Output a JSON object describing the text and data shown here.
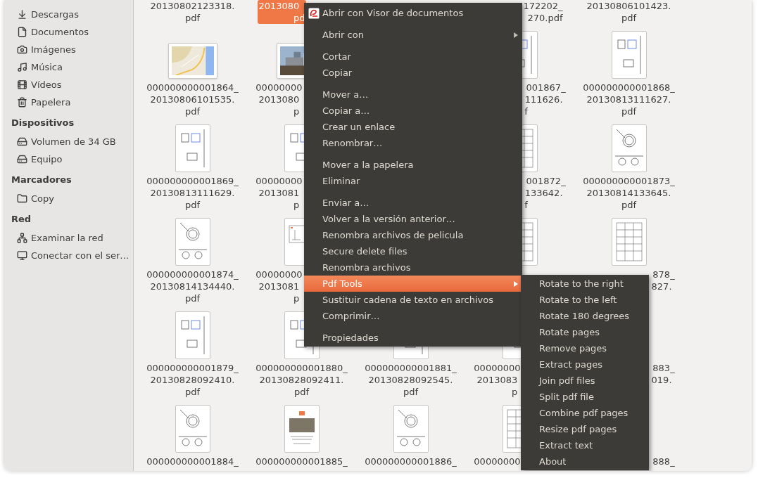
{
  "sidebar": {
    "sections": [
      {
        "items": [
          {
            "label": "Descargas",
            "selected": false
          },
          {
            "label": "Documentos",
            "selected": false
          },
          {
            "label": "Imágenes",
            "selected": false
          },
          {
            "label": "Música",
            "selected": false
          },
          {
            "label": "Vídeos",
            "selected": false
          },
          {
            "label": "Papelera",
            "selected": false
          }
        ]
      },
      {
        "title": "Dispositivos",
        "items": [
          {
            "label": "Volumen de 34 GB",
            "selected": false
          },
          {
            "label": "Equipo",
            "selected": false
          }
        ]
      },
      {
        "title": "Marcadores",
        "items": [
          {
            "label": "Copy",
            "selected": false
          }
        ]
      },
      {
        "title": "Red",
        "items": [
          {
            "label": "Examinar la red",
            "selected": false
          },
          {
            "label": "Conectar con el ser…",
            "selected": false
          }
        ]
      }
    ]
  },
  "files": {
    "rows": [
      {
        "cells": [
          {
            "kind": "file",
            "lines": [
              "20130802123318.",
              "pdf"
            ],
            "selected": false
          },
          {
            "kind": "file",
            "lines": [
              "2013080",
              "pd"
            ],
            "selected": true
          },
          {
            "kind": "covered"
          },
          {
            "kind": "file",
            "lines": [
              "172202_",
              "270.pdf"
            ],
            "selected": false
          },
          {
            "kind": "file",
            "lines": [
              "20130806101423.",
              "pdf"
            ],
            "selected": false
          }
        ]
      },
      {
        "cells": [
          {
            "kind": "file",
            "lines": [
              "000000000001864_",
              "20130806101535.",
              "pdf"
            ],
            "selected": false
          },
          {
            "kind": "file",
            "lines": [
              "00000000",
              "2013080",
              "p"
            ],
            "selected": false
          },
          {
            "kind": "covered"
          },
          {
            "kind": "file",
            "lines": [
              "001867_",
              "111626.",
              "f"
            ],
            "selected": false
          },
          {
            "kind": "file",
            "lines": [
              "000000000001868_",
              "20130813111627.",
              "pdf"
            ],
            "selected": false
          }
        ]
      },
      {
        "cells": [
          {
            "kind": "file",
            "lines": [
              "000000000001869_",
              "20130813111629.",
              "pdf"
            ],
            "selected": false
          },
          {
            "kind": "file",
            "lines": [
              "00000000",
              "2013081",
              "p"
            ],
            "selected": false
          },
          {
            "kind": "covered"
          },
          {
            "kind": "file",
            "lines": [
              "001872_",
              "133642.",
              "f"
            ],
            "selected": false
          },
          {
            "kind": "file",
            "lines": [
              "000000000001873_",
              "20130814133645.",
              "pdf"
            ],
            "selected": false
          }
        ]
      },
      {
        "cells": [
          {
            "kind": "file",
            "lines": [
              "000000000001874_",
              "20130814134440.",
              "pdf"
            ],
            "selected": false
          },
          {
            "kind": "file",
            "lines": [
              "00000000",
              "2013081",
              "p"
            ],
            "selected": false
          },
          {
            "kind": "covered"
          },
          {
            "kind": "covered"
          },
          {
            "kind": "file",
            "lines": [
              "878_",
              "827."
            ],
            "selected": false
          }
        ]
      },
      {
        "cells": [
          {
            "kind": "file",
            "lines": [
              "000000000001879_",
              "20130828092410.",
              "pdf"
            ],
            "selected": false
          },
          {
            "kind": "file",
            "lines": [
              "000000000001880_",
              "20130828092411.",
              "pdf"
            ],
            "selected": false
          },
          {
            "kind": "file",
            "lines": [
              "000000000001881_",
              "20130828092545.",
              "pdf"
            ],
            "selected": false
          },
          {
            "kind": "file",
            "lines": [
              "00000000",
              "2013083",
              "p"
            ],
            "selected": false
          },
          {
            "kind": "file",
            "lines": [
              "883_",
              "019."
            ],
            "selected": false
          }
        ]
      },
      {
        "cells": [
          {
            "kind": "file",
            "lines": [
              "000000000001884_"
            ],
            "selected": false
          },
          {
            "kind": "file",
            "lines": [
              "000000000001885_"
            ],
            "selected": false
          },
          {
            "kind": "file",
            "lines": [
              "000000000001886_"
            ],
            "selected": false
          },
          {
            "kind": "file",
            "lines": [
              "00000000"
            ],
            "selected": false
          },
          {
            "kind": "file",
            "lines": [
              "888_"
            ],
            "selected": false
          }
        ]
      }
    ]
  },
  "context_menu": {
    "groups": [
      {
        "items": [
          {
            "label": "Abrir con Visor de documentos",
            "submenu": false,
            "selected": false
          }
        ]
      },
      {
        "items": [
          {
            "label": "Abrir con",
            "submenu": true,
            "selected": false
          }
        ]
      },
      {
        "items": [
          {
            "label": "Cortar",
            "submenu": false,
            "selected": false
          },
          {
            "label": "Copiar",
            "submenu": false,
            "selected": false
          }
        ]
      },
      {
        "items": [
          {
            "label": "Mover a…",
            "submenu": false,
            "selected": false
          },
          {
            "label": "Copiar a…",
            "submenu": false,
            "selected": false
          },
          {
            "label": "Crear un enlace",
            "submenu": false,
            "selected": false
          },
          {
            "label": "Renombrar…",
            "submenu": false,
            "selected": false
          }
        ]
      },
      {
        "items": [
          {
            "label": "Mover a la papelera",
            "submenu": false,
            "selected": false
          },
          {
            "label": "Eliminar",
            "submenu": false,
            "selected": false
          }
        ]
      },
      {
        "items": [
          {
            "label": "Enviar a…",
            "submenu": false,
            "selected": false
          },
          {
            "label": "Volver a la versión anterior…",
            "submenu": false,
            "selected": false
          },
          {
            "label": "Renombra archivos de pelicula",
            "submenu": false,
            "selected": false
          },
          {
            "label": "Secure delete files",
            "submenu": false,
            "selected": false
          },
          {
            "label": "Renombra archivos",
            "submenu": false,
            "selected": false
          },
          {
            "label": "Pdf Tools",
            "submenu": true,
            "selected": true
          },
          {
            "label": "Sustituir cadena de texto en archivos",
            "submenu": false,
            "selected": false
          },
          {
            "label": "Comprimir…",
            "submenu": false,
            "selected": false
          }
        ]
      },
      {
        "items": [
          {
            "label": "Propiedades",
            "submenu": false,
            "selected": false
          }
        ]
      }
    ]
  },
  "submenu": {
    "items": [
      {
        "label": "Rotate to the right",
        "selected": false
      },
      {
        "label": "Rotate to the left",
        "selected": false
      },
      {
        "label": "Rotate 180 degrees",
        "selected": false
      },
      {
        "label": "Rotate pages",
        "selected": false
      },
      {
        "label": "Remove pages",
        "selected": false
      },
      {
        "label": "Extract pages",
        "selected": false
      },
      {
        "label": "Join pdf files",
        "selected": false
      },
      {
        "label": "Split pdf file",
        "selected": false
      },
      {
        "label": "Combine pdf pages",
        "selected": false
      },
      {
        "label": "Resize pdf pages",
        "selected": false
      },
      {
        "label": "Extract text",
        "selected": false
      },
      {
        "label": "About",
        "selected": false
      }
    ]
  }
}
